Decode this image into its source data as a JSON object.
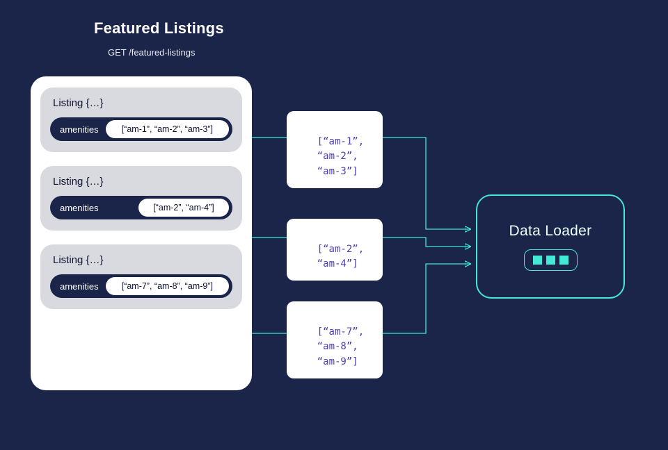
{
  "header": {
    "title": "Featured Listings",
    "subtitle": "GET /featured-listings"
  },
  "listings": [
    {
      "title": "Listing {…}",
      "field_label": "amenities",
      "field_value": "[“am-1”, “am-2”, “am-3”]"
    },
    {
      "title": "Listing {…}",
      "field_label": "amenities",
      "field_value": "[“am-2”, “am-4”]"
    },
    {
      "title": "Listing {…}",
      "field_label": "amenities",
      "field_value": "[“am-7”, “am-8”, “am-9”]"
    }
  ],
  "payloads": [
    "[“am-1”,\n “am-2”,\n “am-3”]",
    "[“am-2”,\n “am-4”]",
    "[“am-7”,\n “am-8”,\n “am-9”]"
  ],
  "loader": {
    "title": "Data Loader"
  },
  "colors": {
    "bg": "#1b2449",
    "accent": "#44e8d6",
    "code": "#4b3fb5"
  }
}
